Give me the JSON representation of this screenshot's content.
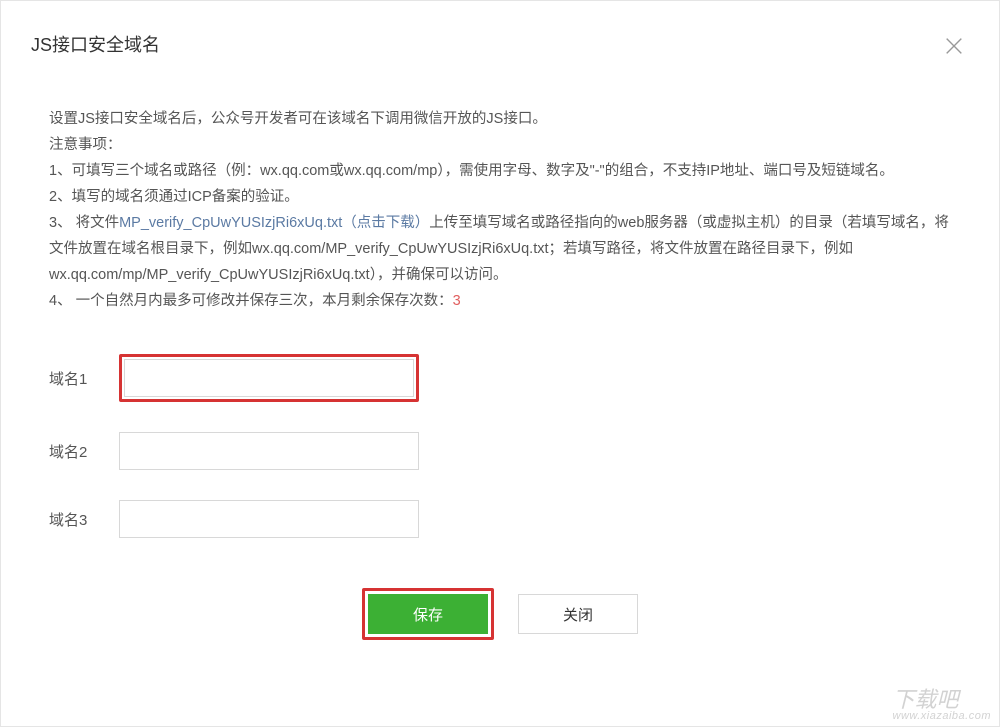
{
  "dialog": {
    "title": "JS接口安全域名"
  },
  "description": {
    "intro": "设置JS接口安全域名后，公众号开发者可在该域名下调用微信开放的JS接口。",
    "notice_label": "注意事项：",
    "item1": "1、可填写三个域名或路径（例：wx.qq.com或wx.qq.com/mp），需使用字母、数字及\"-\"的组合，不支持IP地址、端口号及短链域名。",
    "item2": "2、填写的域名须通过ICP备案的验证。",
    "item3_prefix": "3、 将文件",
    "item3_link": "MP_verify_CpUwYUSIzjRi6xUq.txt（点击下载）",
    "item3_suffix": "上传至填写域名或路径指向的web服务器（或虚拟主机）的目录（若填写域名，将文件放置在域名根目录下，例如wx.qq.com/MP_verify_CpUwYUSIzjRi6xUq.txt；若填写路径，将文件放置在路径目录下，例如wx.qq.com/mp/MP_verify_CpUwYUSIzjRi6xUq.txt），并确保可以访问。",
    "item4_prefix": "4、 一个自然月内最多可修改并保存三次，本月剩余保存次数：",
    "item4_count": "3"
  },
  "form": {
    "fields": [
      {
        "label": "域名1",
        "value": ""
      },
      {
        "label": "域名2",
        "value": ""
      },
      {
        "label": "域名3",
        "value": ""
      }
    ]
  },
  "buttons": {
    "save": "保存",
    "close": "关闭"
  },
  "watermark": {
    "text": "下载吧",
    "url": "www.xiazaiba.com"
  }
}
